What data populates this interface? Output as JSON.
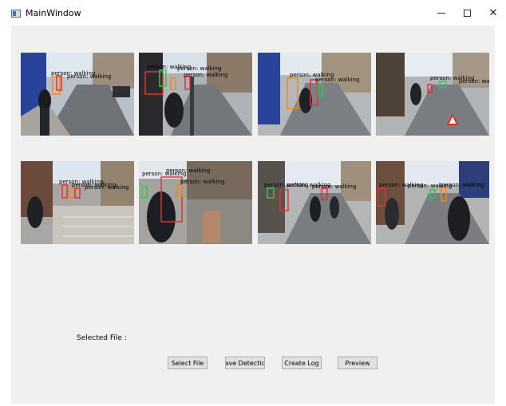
{
  "window": {
    "title": "MainWindow",
    "controls": {
      "minimize": "–",
      "maximize": "□",
      "close": "✕"
    }
  },
  "main": {
    "selected_file_label": "Selected File :",
    "buttons": {
      "select_file": "Select File",
      "save_detection": "Save Detection",
      "create_log": "Create Log",
      "preview": "Preview"
    },
    "frames": [
      {
        "labels": [
          "person: walking",
          "person: walking"
        ]
      },
      {
        "labels": [
          "person: walking",
          "person: walking",
          "person: walking"
        ]
      },
      {
        "labels": [
          "person: walking",
          "person: walking"
        ]
      },
      {
        "labels": [
          "person: walking",
          "person: walking"
        ]
      },
      {
        "labels": [
          "person: walking",
          "person: walking",
          "person: walking"
        ]
      },
      {
        "labels": [
          "person: walking",
          "person: walking",
          "person: walking"
        ]
      },
      {
        "labels": [
          "person: walking",
          "person: walking",
          "person: walking"
        ]
      },
      {
        "labels": [
          "person: walking",
          "person: walking",
          "person: walking"
        ]
      }
    ]
  },
  "colors": {
    "client_background": "#f0f0f0",
    "box_red": "#e53030",
    "box_orange": "#f08a1c",
    "box_green": "#2ecc40"
  }
}
